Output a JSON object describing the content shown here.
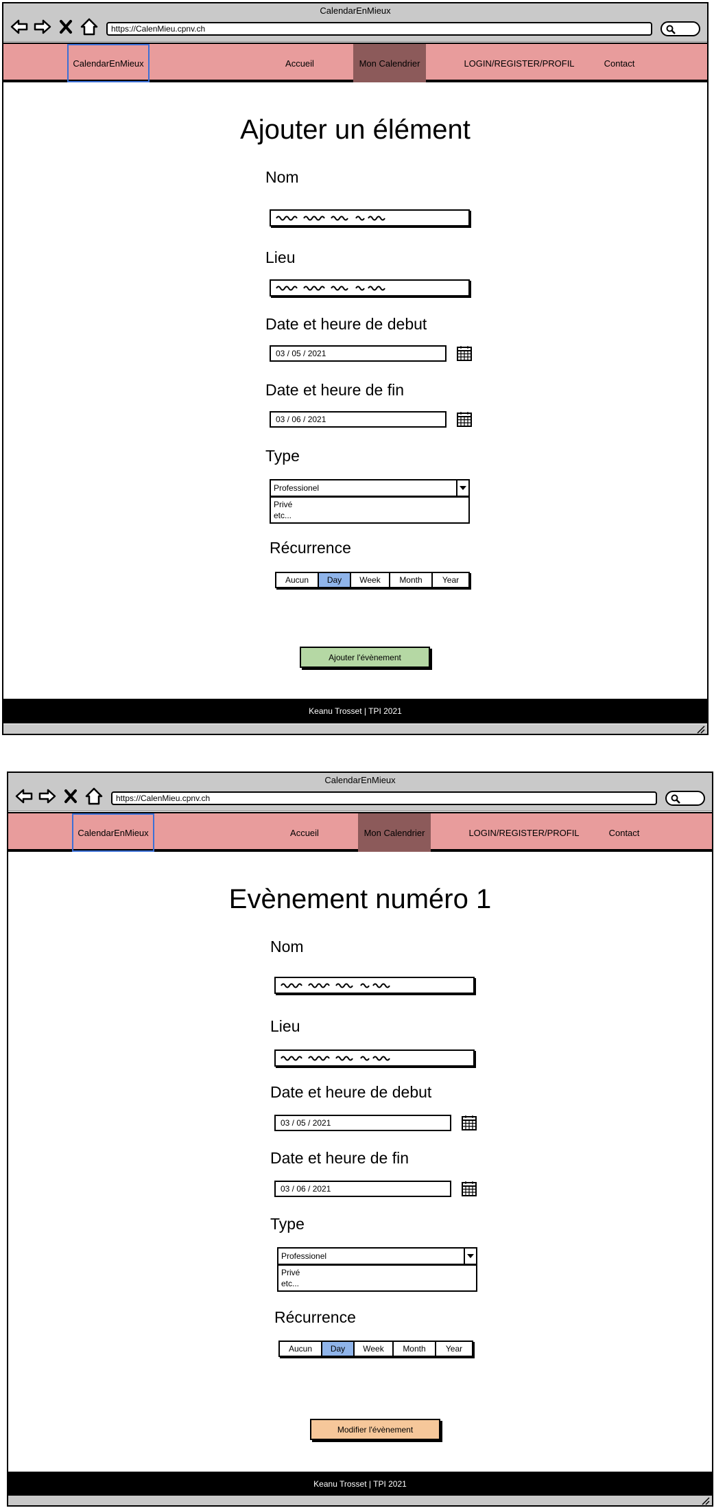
{
  "window": {
    "title": "CalendarEnMieux",
    "url": "https://CalenMieu.cpnv.ch"
  },
  "navbar": {
    "brand": "CalendarEnMieux",
    "accueil": "Accueil",
    "calendrier": "Mon Calendrier",
    "login": "LOGIN/REGISTER/PROFIL",
    "contact": "Contact"
  },
  "icons": {
    "back": "arrow-left-icon",
    "forward": "arrow-right-icon",
    "stop": "close-icon",
    "home": "home-icon",
    "search": "search-icon",
    "calendar": "calendar-icon",
    "dropdown": "chevron-down-icon"
  },
  "colors": {
    "navbar": "#e89c9c",
    "active_nav": "#8c5a5a",
    "brand_border": "#3b6fd6",
    "active_segment": "#8fb4ea",
    "add_button": "#b5d8a4",
    "edit_button": "#f6c79a",
    "footer": "#000000"
  },
  "forms": [
    {
      "title": "Ajouter un élément",
      "labels": {
        "nom": "Nom",
        "lieu": "Lieu",
        "debut": "Date et heure de debut",
        "fin": "Date et heure de fin",
        "type": "Type",
        "recurrence": "Récurrence"
      },
      "date_debut": "03 / 05 / 2021",
      "date_fin": "03 / 06 / 2021",
      "type_selected": "Professionel",
      "type_options": [
        "Privé",
        "etc..."
      ],
      "recurrence_options": [
        "Aucun",
        "Day",
        "Week",
        "Month",
        "Year"
      ],
      "recurrence_selected": "Day",
      "button": "Ajouter l'évènement"
    },
    {
      "title": "Evènement numéro 1",
      "labels": {
        "nom": "Nom",
        "lieu": "Lieu",
        "debut": "Date et heure de debut",
        "fin": "Date et heure de fin",
        "type": "Type",
        "recurrence": "Récurrence"
      },
      "date_debut": "03 / 05 / 2021",
      "date_fin": "03 / 06 / 2021",
      "type_selected": "Professionel",
      "type_options": [
        "Privé",
        "etc..."
      ],
      "recurrence_options": [
        "Aucun",
        "Day",
        "Week",
        "Month",
        "Year"
      ],
      "recurrence_selected": "Day",
      "button": "Modifier l'évènement"
    }
  ],
  "footer": "Keanu Trosset | TPI 2021"
}
